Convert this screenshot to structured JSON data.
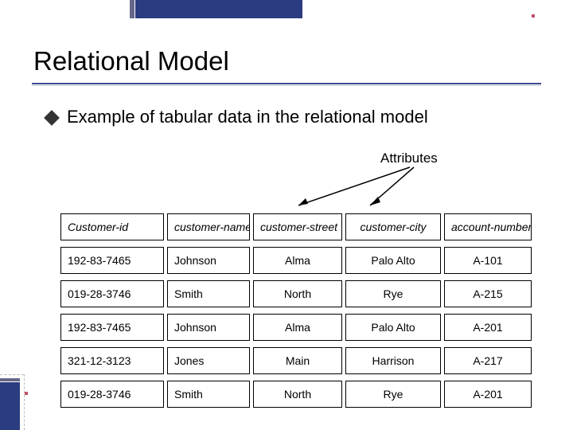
{
  "title": "Relational Model",
  "bullet": "Example of tabular data in the relational model",
  "attributes_label": "Attributes",
  "headers": {
    "c0": "Customer-id",
    "c1": "customer-name",
    "c2": "customer-street",
    "c3": "customer-city",
    "c4": "account-number"
  },
  "rows": [
    {
      "id": "192-83-7465",
      "name": "Johnson",
      "street": "Alma",
      "city": "Palo Alto",
      "acct": "A-101"
    },
    {
      "id": "019-28-3746",
      "name": "Smith",
      "street": "North",
      "city": "Rye",
      "acct": "A-215"
    },
    {
      "id": "192-83-7465",
      "name": "Johnson",
      "street": "Alma",
      "city": "Palo Alto",
      "acct": "A-201"
    },
    {
      "id": "321-12-3123",
      "name": "Jones",
      "street": "Main",
      "city": "Harrison",
      "acct": "A-217"
    },
    {
      "id": "019-28-3746",
      "name": "Smith",
      "street": "North",
      "city": "Rye",
      "acct": "A-201"
    }
  ]
}
